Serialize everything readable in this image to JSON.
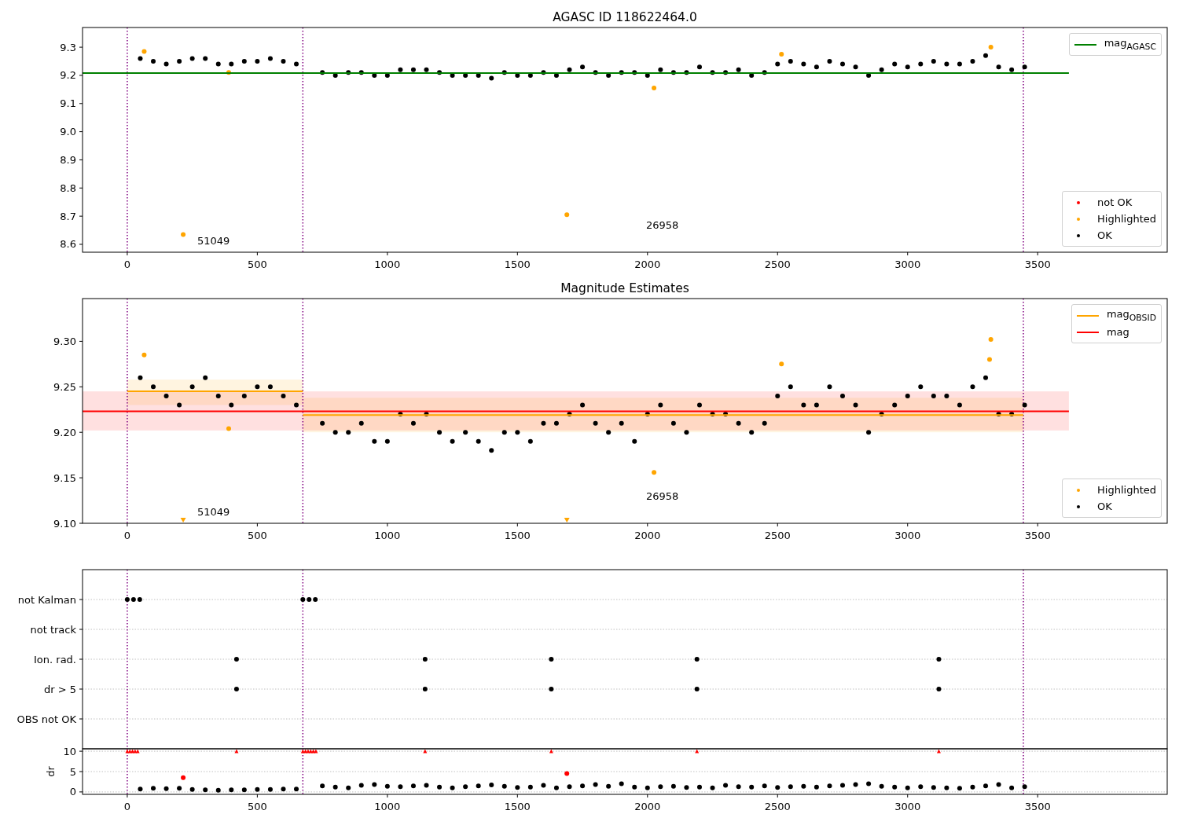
{
  "panels": [
    {
      "chart_data": {
        "type": "scatter",
        "title": "AGASC ID 118622464.0",
        "xlim": [
          -172,
          3998
        ],
        "ylim": [
          8.572,
          9.37
        ],
        "xticks": [
          0,
          500,
          1000,
          1500,
          2000,
          2500,
          3000,
          3500
        ],
        "yticks": [
          {
            "value": 8.6,
            "label": "8.6"
          },
          {
            "value": 8.7,
            "label": "8.7"
          },
          {
            "value": 8.8,
            "label": "8.8"
          },
          {
            "value": 8.9,
            "label": "8.9"
          },
          {
            "value": 9.0,
            "label": "9.0"
          },
          {
            "value": 9.1,
            "label": "9.1"
          },
          {
            "value": 9.2,
            "label": "9.2"
          },
          {
            "value": 9.3,
            "label": "9.3"
          }
        ],
        "x": [
          50,
          100,
          150,
          200,
          250,
          300,
          350,
          400,
          450,
          500,
          550,
          600,
          650,
          750,
          800,
          850,
          900,
          950,
          1000,
          1050,
          1100,
          1150,
          1200,
          1250,
          1300,
          1350,
          1400,
          1450,
          1500,
          1550,
          1600,
          1650,
          1700,
          1750,
          1800,
          1850,
          1900,
          1950,
          2000,
          2050,
          2100,
          2150,
          2200,
          2250,
          2300,
          2350,
          2400,
          2450,
          2500,
          2550,
          2600,
          2650,
          2700,
          2750,
          2800,
          2850,
          2900,
          2950,
          3000,
          3050,
          3100,
          3150,
          3200,
          3250,
          3300,
          3350,
          3400,
          3450
        ],
        "series": [
          {
            "name": "not OK",
            "type": "scatter",
            "color": "#ff0000",
            "values": [
              null,
              null,
              null,
              null,
              null,
              null,
              null,
              null,
              null,
              null,
              null,
              null,
              null,
              null,
              null,
              null,
              null,
              null,
              null,
              null,
              null,
              null,
              null,
              null,
              null,
              null,
              null,
              null,
              null,
              null,
              null,
              null,
              null,
              null,
              null,
              null,
              null,
              null,
              null,
              null,
              null,
              null,
              null,
              null,
              null,
              null,
              null,
              null,
              null,
              null,
              null,
              null,
              null,
              null,
              null,
              null,
              null,
              null,
              null,
              null,
              null,
              null,
              null,
              null,
              null,
              null,
              null,
              null
            ]
          },
          {
            "name": "Highlighted",
            "type": "scatter",
            "color": "#ffa500",
            "x": [
              65,
              215,
              390,
              1690,
              2025,
              2515,
              3320
            ],
            "values": [
              9.285,
              8.635,
              9.21,
              8.705,
              9.155,
              9.275,
              9.3
            ]
          },
          {
            "name": "OK",
            "type": "scatter",
            "color": "#000000",
            "values": [
              9.26,
              9.25,
              9.24,
              9.25,
              9.26,
              9.26,
              9.24,
              9.24,
              9.25,
              9.25,
              9.26,
              9.25,
              9.24,
              9.21,
              9.2,
              9.21,
              9.21,
              9.2,
              9.2,
              9.22,
              9.22,
              9.22,
              9.21,
              9.2,
              9.2,
              9.2,
              9.19,
              9.21,
              9.2,
              9.2,
              9.21,
              9.2,
              9.22,
              9.23,
              9.21,
              9.2,
              9.21,
              9.21,
              9.2,
              9.22,
              9.21,
              9.21,
              9.23,
              9.21,
              9.21,
              9.22,
              9.2,
              9.21,
              9.24,
              9.25,
              9.24,
              9.23,
              9.25,
              9.24,
              9.23,
              9.2,
              9.22,
              9.24,
              9.23,
              9.24,
              9.25,
              9.24,
              9.24,
              9.25,
              9.27,
              9.23,
              9.22,
              9.23
            ]
          },
          {
            "name": "mag$_{AGASC}$",
            "type": "line",
            "color": "#008000",
            "x": [
              -172,
              3620
            ],
            "values": [
              9.208,
              9.208
            ]
          }
        ],
        "ref_lines": [
          {
            "axis": "x",
            "value": 0,
            "color": "#800080"
          },
          {
            "axis": "x",
            "value": 675,
            "color": "#800080"
          },
          {
            "axis": "x",
            "value": 3445,
            "color": "#800080"
          }
        ],
        "annotations": [
          "51049",
          "26958"
        ]
      }
    },
    {
      "chart_data": {
        "type": "scatter",
        "title": "Magnitude Estimates",
        "xlim": [
          -172,
          3998
        ],
        "ylim": [
          9.1,
          9.347
        ],
        "xticks": [
          0,
          500,
          1000,
          1500,
          2000,
          2500,
          3000,
          3500
        ],
        "yticks": [
          {
            "value": 9.1,
            "label": "9.10"
          },
          {
            "value": 9.15,
            "label": "9.15"
          },
          {
            "value": 9.2,
            "label": "9.20"
          },
          {
            "value": 9.25,
            "label": "9.25"
          },
          {
            "value": 9.3,
            "label": "9.30"
          }
        ],
        "x": [
          50,
          100,
          150,
          200,
          250,
          300,
          350,
          400,
          450,
          500,
          550,
          600,
          650,
          750,
          800,
          850,
          900,
          950,
          1000,
          1050,
          1100,
          1150,
          1200,
          1250,
          1300,
          1350,
          1400,
          1450,
          1500,
          1550,
          1600,
          1650,
          1700,
          1750,
          1800,
          1850,
          1900,
          1950,
          2000,
          2050,
          2100,
          2150,
          2200,
          2250,
          2300,
          2350,
          2400,
          2450,
          2500,
          2550,
          2600,
          2650,
          2700,
          2750,
          2800,
          2850,
          2900,
          2950,
          3000,
          3050,
          3100,
          3150,
          3200,
          3250,
          3300,
          3350,
          3400,
          3450
        ],
        "series": [
          {
            "name": "Highlighted",
            "type": "scatter",
            "color": "#ffa500",
            "x": [
              65,
              215,
              390,
              1690,
              2025,
              2515,
              3315,
              3320
            ],
            "values": [
              9.285,
              9.103,
              9.204,
              9.103,
              9.156,
              9.275,
              9.28,
              9.302
            ]
          },
          {
            "name": "OK",
            "type": "scatter",
            "color": "#000000",
            "values": [
              9.26,
              9.25,
              9.24,
              9.23,
              9.25,
              9.26,
              9.24,
              9.23,
              9.24,
              9.25,
              9.25,
              9.24,
              9.23,
              9.21,
              9.2,
              9.2,
              9.21,
              9.19,
              9.19,
              9.22,
              9.21,
              9.22,
              9.2,
              9.19,
              9.2,
              9.19,
              9.18,
              9.2,
              9.2,
              9.19,
              9.21,
              9.21,
              9.22,
              9.23,
              9.21,
              9.2,
              9.21,
              9.19,
              9.22,
              9.23,
              9.21,
              9.2,
              9.23,
              9.22,
              9.22,
              9.21,
              9.2,
              9.21,
              9.24,
              9.25,
              9.23,
              9.23,
              9.25,
              9.24,
              9.23,
              9.2,
              9.22,
              9.23,
              9.24,
              9.25,
              9.24,
              9.24,
              9.23,
              9.25,
              9.26,
              9.22,
              9.22,
              9.23
            ]
          },
          {
            "name": "mag$_{OBSID}$",
            "type": "line",
            "color": "#ffa500",
            "x": [
              0,
              675,
              null,
              675,
              3445
            ],
            "values": [
              9.245,
              9.245,
              null,
              9.219,
              9.219
            ]
          },
          {
            "name": "mag",
            "type": "line",
            "color": "#ff0000",
            "x": [
              -172,
              3620
            ],
            "values": [
              9.223,
              9.223
            ]
          }
        ],
        "bands": [
          {
            "axis": "y",
            "from": 9.202,
            "to": 9.245,
            "color": "#ff0000"
          },
          {
            "axis": "y",
            "from": 9.23,
            "to": 9.258,
            "color": "#ffa500"
          },
          {
            "axis": "y",
            "from": 9.2,
            "to": 9.238,
            "color": "#ffa500"
          }
        ],
        "ref_lines": [
          {
            "axis": "x",
            "value": 0,
            "color": "#800080"
          },
          {
            "axis": "x",
            "value": 675,
            "color": "#800080"
          },
          {
            "axis": "x",
            "value": 3445,
            "color": "#800080"
          }
        ],
        "annotations": [
          "51049",
          "26958"
        ]
      }
    },
    {
      "chart_data": {
        "type": "scatter",
        "orientation": "horizontal",
        "grid": true,
        "xlim": [
          -172,
          3998
        ],
        "categories": [
          "not Kalman",
          "not track",
          "Ion. rad.",
          "dr > 5",
          "OBS not OK"
        ],
        "series": [
          {
            "type": "scatter",
            "color": "#000000",
            "values": [
              0,
              null,
              420,
              420,
              null
            ]
          },
          {
            "type": "scatter",
            "color": "#000000",
            "values": [
              24,
              null,
              1145,
              1145,
              null
            ]
          },
          {
            "type": "scatter",
            "color": "#000000",
            "values": [
              48,
              null,
              1630,
              1630,
              null
            ]
          },
          {
            "type": "scatter",
            "color": "#000000",
            "values": [
              675,
              null,
              2190,
              2190,
              null
            ]
          },
          {
            "type": "scatter",
            "color": "#000000",
            "values": [
              699,
              null,
              3120,
              3120,
              null
            ]
          },
          {
            "type": "scatter",
            "color": "#000000",
            "values": [
              723,
              null,
              null,
              null,
              null
            ]
          }
        ],
        "ref_lines": [
          {
            "axis": "x",
            "value": 0,
            "color": "#800080"
          },
          {
            "axis": "x",
            "value": 675,
            "color": "#800080"
          },
          {
            "axis": "x",
            "value": 3445,
            "color": "#800080"
          }
        ]
      }
    },
    {
      "chart_data": {
        "type": "scatter",
        "ylabel": "dr",
        "grid": true,
        "xlim": [
          -172,
          3998
        ],
        "ylim": [
          -0.6,
          10.6
        ],
        "xticks": [
          0,
          500,
          1000,
          1500,
          2000,
          2500,
          3000,
          3500
        ],
        "yticks": [
          0,
          5,
          10
        ],
        "x": [
          50,
          100,
          150,
          200,
          250,
          300,
          350,
          400,
          450,
          500,
          550,
          600,
          650,
          750,
          800,
          850,
          900,
          950,
          1000,
          1050,
          1100,
          1150,
          1200,
          1250,
          1300,
          1350,
          1400,
          1450,
          1500,
          1550,
          1600,
          1650,
          1700,
          1750,
          1800,
          1850,
          1900,
          1950,
          2000,
          2050,
          2100,
          2150,
          2200,
          2250,
          2300,
          2350,
          2400,
          2450,
          2500,
          2550,
          2600,
          2650,
          2700,
          2750,
          2800,
          2850,
          2900,
          2950,
          3000,
          3050,
          3100,
          3150,
          3200,
          3250,
          3300,
          3350,
          3400,
          3450
        ],
        "series": [
          {
            "type": "scatter",
            "color": "#000000",
            "values": [
              0.7,
              0.9,
              0.8,
              0.9,
              0.6,
              0.5,
              0.4,
              0.5,
              0.5,
              0.6,
              0.6,
              0.7,
              0.7,
              1.5,
              1.2,
              1.0,
              1.6,
              1.8,
              1.4,
              1.3,
              1.5,
              1.6,
              1.2,
              1.0,
              1.3,
              1.5,
              1.7,
              1.4,
              1.1,
              1.2,
              1.6,
              1.0,
              1.3,
              1.5,
              1.8,
              1.4,
              2.0,
              1.2,
              1.0,
              1.3,
              1.4,
              1.1,
              1.2,
              1.0,
              1.6,
              1.3,
              1.2,
              1.5,
              1.1,
              1.3,
              1.4,
              1.2,
              1.5,
              1.6,
              1.8,
              2.0,
              1.4,
              1.2,
              1.0,
              1.3,
              1.1,
              1.0,
              0.9,
              1.2,
              1.5,
              1.8,
              1.0,
              1.3
            ]
          },
          {
            "type": "scatter",
            "color": "#ff0000",
            "x": [
              215,
              1690,
              0,
              10,
              20,
              30,
              40,
              420,
              675,
              685,
              695,
              705,
              715,
              725,
              1145,
              1630,
              2190,
              3120
            ],
            "values": [
              3.5,
              4.5,
              10,
              10,
              10,
              10,
              10,
              10,
              10,
              10,
              10,
              10,
              10,
              10,
              10,
              10,
              10,
              10
            ]
          }
        ],
        "ref_lines": [
          {
            "axis": "x",
            "value": 0,
            "color": "#800080"
          },
          {
            "axis": "x",
            "value": 675,
            "color": "#800080"
          },
          {
            "axis": "x",
            "value": 3445,
            "color": "#800080"
          }
        ]
      }
    }
  ]
}
